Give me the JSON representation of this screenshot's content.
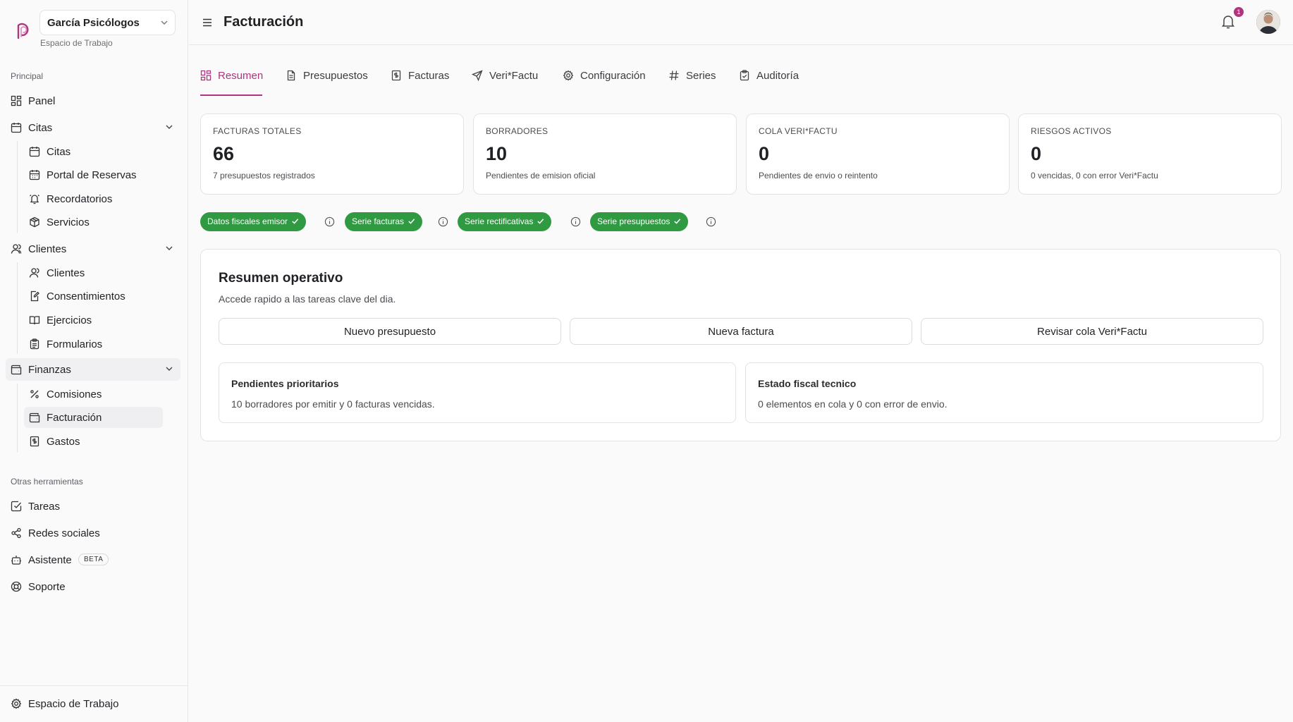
{
  "workspace": {
    "name": "García Psicólogos",
    "subtitle": "Espacio de Trabajo"
  },
  "sidebar": {
    "section_principal": "Principal",
    "panel": "Panel",
    "citas": {
      "label": "Citas",
      "items": [
        "Citas",
        "Portal de Reservas",
        "Recordatorios",
        "Servicios"
      ]
    },
    "clientes": {
      "label": "Clientes",
      "items": [
        "Clientes",
        "Consentimientos",
        "Ejercicios",
        "Formularios"
      ]
    },
    "finanzas": {
      "label": "Finanzas",
      "items": [
        "Comisiones",
        "Facturación",
        "Gastos"
      ]
    },
    "section_otras": "Otras herramientas",
    "otras": [
      "Tareas",
      "Redes sociales",
      "Asistente",
      "Soporte"
    ],
    "beta_badge": "BETA",
    "footer": "Espacio de Trabajo"
  },
  "header": {
    "title": "Facturación",
    "notifications": "1"
  },
  "tabs": [
    "Resumen",
    "Presupuestos",
    "Facturas",
    "Veri*Factu",
    "Configuración",
    "Series",
    "Auditoría"
  ],
  "active_tab": "Resumen",
  "stats": [
    {
      "label": "FACTURAS TOTALES",
      "value": "66",
      "desc": "7 presupuestos registrados"
    },
    {
      "label": "BORRADORES",
      "value": "10",
      "desc": "Pendientes de emision oficial"
    },
    {
      "label": "COLA VERI*FACTU",
      "value": "0",
      "desc": "Pendientes de envio o reintento"
    },
    {
      "label": "RIESGOS ACTIVOS",
      "value": "0",
      "desc": "0 vencidas, 0 con error Veri*Factu"
    }
  ],
  "checks": [
    "Datos fiscales emisor",
    "Serie facturas",
    "Serie rectificativas",
    "Serie presupuestos"
  ],
  "resumen": {
    "title": "Resumen operativo",
    "subtitle": "Accede rapido a las tareas clave del dia.",
    "actions": [
      "Nuevo presupuesto",
      "Nueva factura",
      "Revisar cola Veri*Factu"
    ],
    "cards": [
      {
        "title": "Pendientes prioritarios",
        "text": "10 borradores por emitir y 0 facturas vencidas."
      },
      {
        "title": "Estado fiscal tecnico",
        "text": "0 elementos en cola y 0 con error de envio."
      }
    ]
  },
  "colors": {
    "accent": "#b0347f",
    "success": "#2f9a41",
    "border": "#e3e3e6"
  }
}
